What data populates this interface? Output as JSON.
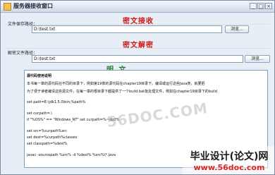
{
  "window": {
    "title": "服务器接收窗口",
    "minimize": "_",
    "maximize": "□",
    "close": "×"
  },
  "receive": {
    "heading": "密文接收",
    "label": "文件保存路径：",
    "path_value": "D:\\test.txt",
    "button": "浏览..."
  },
  "decrypt": {
    "heading": "密文解密",
    "label": "解密文件路径：",
    "path_value": "D:\\test.txt",
    "button": "浏览..."
  },
  "plaintext": {
    "heading": "明  文",
    "lines": [
      "源代码使用说明",
      "本书每一章的源代码在不同的目录下，例如第19章的源代码在chapter19目录下。编译或运行这些Java类，就要把",
      "为了便于读者编译这些源文件，在每一章的根目录下都提供了一个build.bat批处理文件，例如在chapter19目录下的build",
      "set path=E:\\jdk1.5.0\\bin;%path%",
      "set curpath=.\\",
      "if \"%OS%\" == \"Windows_NT\" set curpath=%~dp0%",
      "set src=%curpath%src",
      "set dest=%curpath%classes",
      "set classpath=%dest%",
      "javac -sourcepath %src% -d %dest% %src%\\*.java"
    ]
  },
  "watermarks": {
    "center": "56DOC.COM",
    "badge_title": "毕业设计(论文)网",
    "badge_url": "www.56doc.com"
  }
}
